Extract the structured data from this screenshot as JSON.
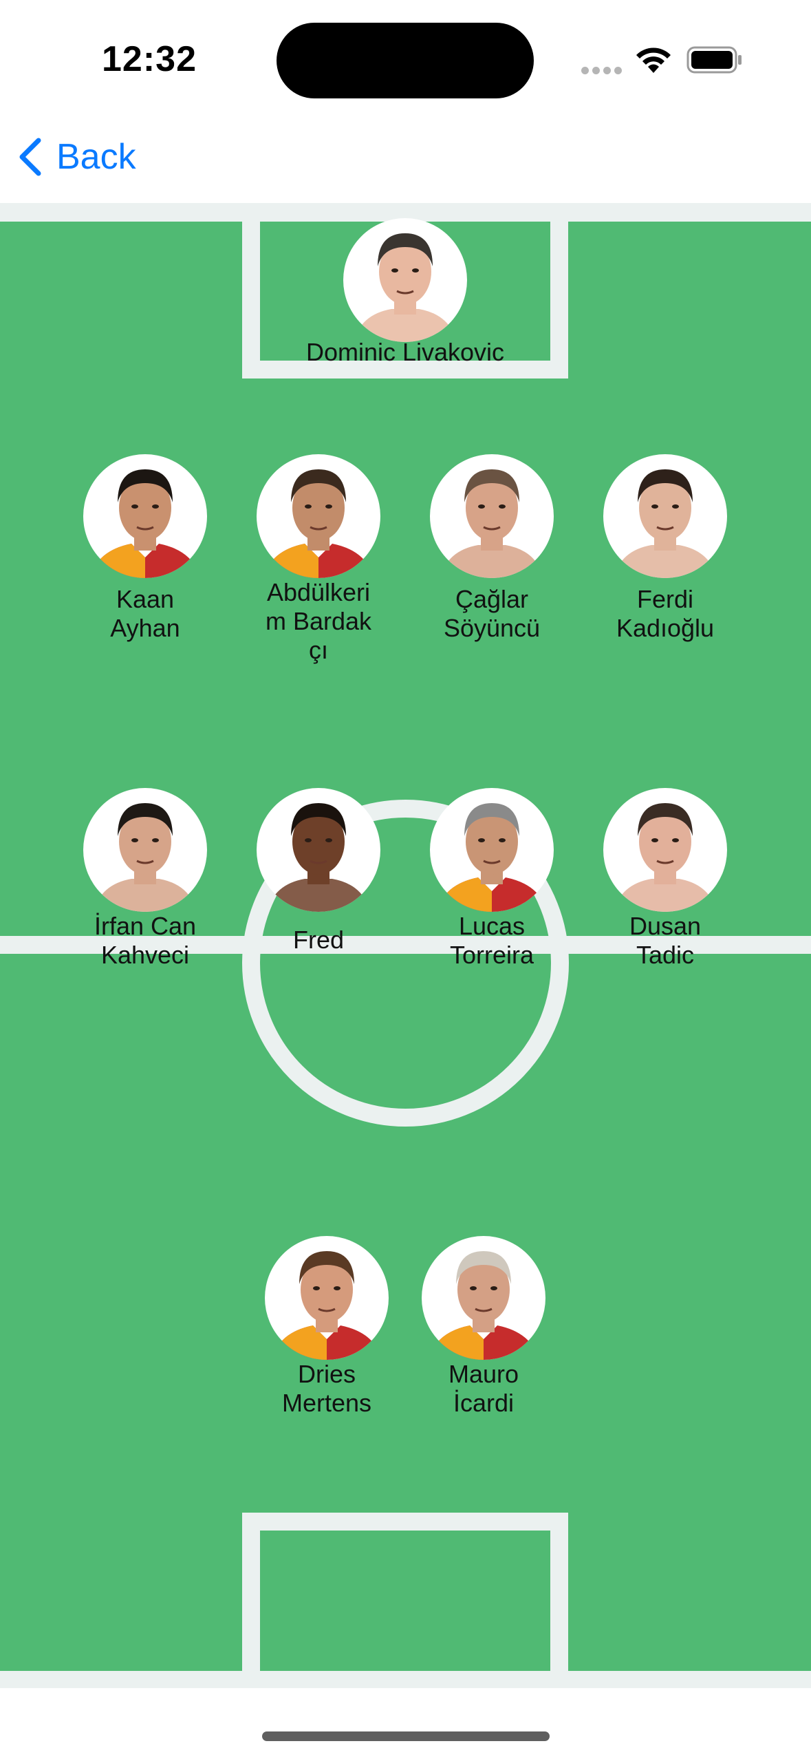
{
  "status_bar": {
    "time": "12:32"
  },
  "nav": {
    "back_label": "Back"
  },
  "lineup": {
    "goalkeeper": {
      "name": "Dominic Livakovic",
      "skin": "#e8b8a0",
      "hair": "#3a3530",
      "kit": "none"
    },
    "defenders": [
      {
        "name": "Kaan Ayhan",
        "skin": "#c9916f",
        "hair": "#1c1612",
        "kit": "gs"
      },
      {
        "name": "Abdülkerim Bardakçı",
        "skin": "#c28c6a",
        "hair": "#3b2a1e",
        "kit": "gs"
      },
      {
        "name": "Çağlar Söyüncü",
        "skin": "#d7a388",
        "hair": "#6a5342",
        "kit": "none"
      },
      {
        "name": "Ferdi Kadıoğlu",
        "skin": "#e0b39a",
        "hair": "#2e211a",
        "kit": "none"
      }
    ],
    "midfielders": [
      {
        "name": "İrfan Can Kahveci",
        "skin": "#d6a489",
        "hair": "#1e1915",
        "kit": "none"
      },
      {
        "name": "Fred",
        "skin": "#6e4029",
        "hair": "#1a120d",
        "kit": "none"
      },
      {
        "name": "Lucas Torreira",
        "skin": "#c99575",
        "hair": "#8a8a8a",
        "kit": "gs"
      },
      {
        "name": "Dusan Tadic",
        "skin": "#e2b09a",
        "hair": "#3a2c24",
        "kit": "none"
      }
    ],
    "forwards": [
      {
        "name": "Dries Mertens",
        "skin": "#d59b7c",
        "hair": "#5a3a24",
        "kit": "gs"
      },
      {
        "name": "Mauro İcardi",
        "skin": "#d4a085",
        "hair": "#cfc8bd",
        "kit": "gs"
      }
    ]
  },
  "colors": {
    "pitch": "#50ba73",
    "lines": "#ebf1f0",
    "accent": "#0a7aff",
    "kit_yellow": "#f3a21f",
    "kit_red": "#c62c2c"
  },
  "icons": [
    "chevron-left-icon",
    "wifi-icon",
    "battery-icon",
    "signal-icon"
  ]
}
